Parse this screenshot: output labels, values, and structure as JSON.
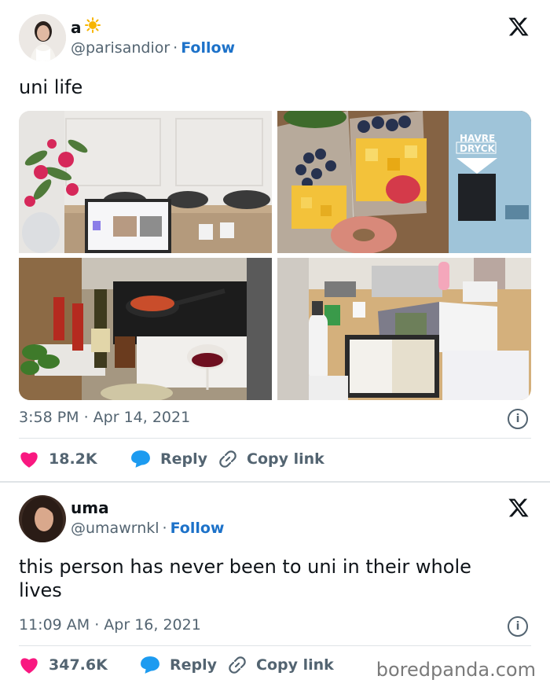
{
  "tweets": [
    {
      "name": "a",
      "name_emoji": "sun-with-face",
      "handle": "@parisandior",
      "separator": "·",
      "follow": "Follow",
      "text": "uni life",
      "time": "3:58 PM · Apr 14, 2021",
      "likes": "18.2K",
      "reply": "Reply",
      "copy_link": "Copy link",
      "photos": [
        {
          "name": "photo-laptop-flowers"
        },
        {
          "name": "photo-fruit-cups-oat-milk",
          "carton_text_1": "HAVRE",
          "carton_text_2": "DRYCK"
        },
        {
          "name": "photo-kitchen-cooking"
        },
        {
          "name": "photo-desk-study"
        }
      ]
    },
    {
      "name": "uma",
      "handle": "@umawrnkl",
      "separator": "·",
      "follow": "Follow",
      "text": "this person has never been to uni in their whole lives",
      "time": "11:09 AM · Apr 16, 2021",
      "likes": "347.6K",
      "reply": "Reply",
      "copy_link": "Copy link"
    }
  ],
  "watermark": "boredpanda.com",
  "colors": {
    "accent": "#1d72c9",
    "like": "#f91880",
    "reply": "#1d9bf0",
    "muted": "#536471"
  }
}
